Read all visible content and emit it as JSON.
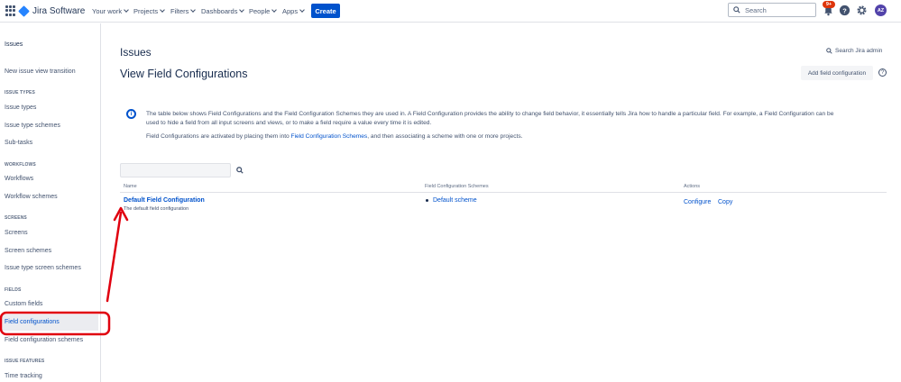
{
  "topnav": {
    "product": "Jira Software",
    "items": [
      {
        "label": "Your work"
      },
      {
        "label": "Projects"
      },
      {
        "label": "Filters"
      },
      {
        "label": "Dashboards"
      },
      {
        "label": "People"
      },
      {
        "label": "Apps"
      }
    ],
    "create_label": "Create",
    "search_placeholder": "Search",
    "notifications_badge": "9+",
    "avatar_initials": "AZ"
  },
  "sidebar": {
    "title": "Issues",
    "top_item": "New issue view transition",
    "sections": [
      {
        "heading": "ISSUE TYPES",
        "items": [
          "Issue types",
          "Issue type schemes",
          "Sub-tasks"
        ]
      },
      {
        "heading": "WORKFLOWS",
        "items": [
          "Workflows",
          "Workflow schemes"
        ]
      },
      {
        "heading": "SCREENS",
        "items": [
          "Screens",
          "Screen schemes",
          "Issue type screen schemes"
        ]
      },
      {
        "heading": "FIELDS",
        "items": [
          "Custom fields",
          "Field configurations",
          "Field configuration schemes"
        ]
      },
      {
        "heading": "ISSUE FEATURES",
        "items": [
          "Time tracking"
        ]
      }
    ],
    "active_item": "Field configurations"
  },
  "main": {
    "page_title": "Issues",
    "admin_search": "Search Jira admin",
    "heading": "View Field Configurations",
    "add_button": "Add field configuration",
    "help_glyph": "?",
    "info": {
      "line1": "The table below shows Field Configurations and the Field Configuration Schemes they are used in. A Field Configuration provides the ability to change field behavior, it essentially tells Jira how to handle a particular field. For example, a Field Configuration can be",
      "line2": "used to hide a field from all input screens and views, or to make a field require a value every time it is edited.",
      "line3_pre": "Field Configurations are activated by placing them into ",
      "line3_link": "Field Configuration Schemes",
      "line3_post": ", and then associating a scheme with one or more projects."
    },
    "table": {
      "columns": [
        "Name",
        "Field Configuration Schemes",
        "Actions"
      ],
      "rows": [
        {
          "name": "Default Field Configuration",
          "description": "The default field configuration",
          "schemes": [
            "Default scheme"
          ],
          "actions": [
            "Configure",
            "Copy"
          ]
        }
      ]
    }
  },
  "colors": {
    "primary": "#0052cc",
    "annotation": "#e0000f"
  }
}
